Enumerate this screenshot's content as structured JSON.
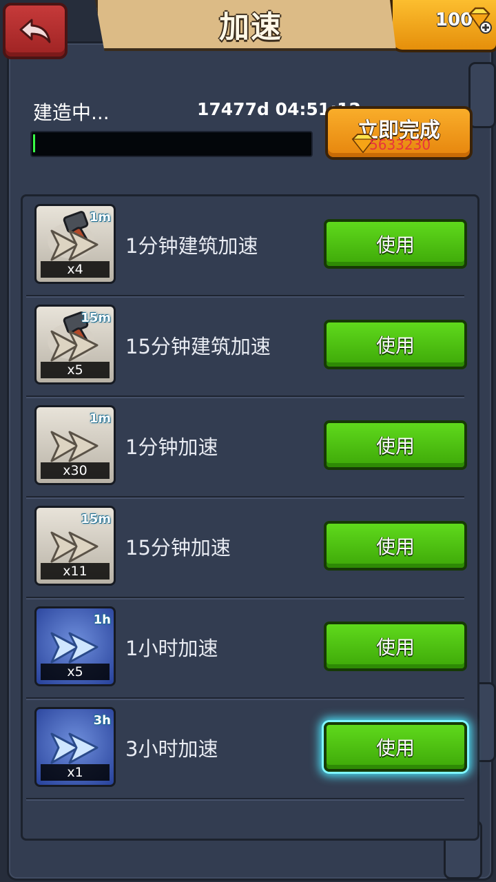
{
  "header": {
    "title": "加速",
    "gem_count": "100"
  },
  "build": {
    "status": "建造中...",
    "remaining": "17477d 04:51:12",
    "progress": 0.005
  },
  "finish": {
    "label": "立即完成",
    "cost": "5633230"
  },
  "items": [
    {
      "name": "1分钟建筑加速",
      "duration": "1m",
      "qty": "x4",
      "kind": "building",
      "action": "使用"
    },
    {
      "name": "15分钟建筑加速",
      "duration": "15m",
      "qty": "x5",
      "kind": "building",
      "action": "使用"
    },
    {
      "name": "1分钟加速",
      "duration": "1m",
      "qty": "x30",
      "kind": "plain",
      "action": "使用"
    },
    {
      "name": "15分钟加速",
      "duration": "15m",
      "qty": "x11",
      "kind": "plain",
      "action": "使用"
    },
    {
      "name": "1小时加速",
      "duration": "1h",
      "qty": "x5",
      "kind": "blue",
      "action": "使用"
    },
    {
      "name": "3小时加速",
      "duration": "3h",
      "qty": "x1",
      "kind": "blue",
      "action": "使用",
      "highlighted": true
    }
  ],
  "colors": {
    "background": "#2b3344",
    "panel": "#333d51",
    "use_button": "#4cc010",
    "finish_button": "#f2a11f",
    "progress": "#39ff46",
    "cost_text": "#e8343c"
  },
  "icons": {
    "back": "back-arrow-icon",
    "gem": "gem-icon",
    "speed": "double-chevron-icon",
    "hammer": "hammer-icon"
  }
}
